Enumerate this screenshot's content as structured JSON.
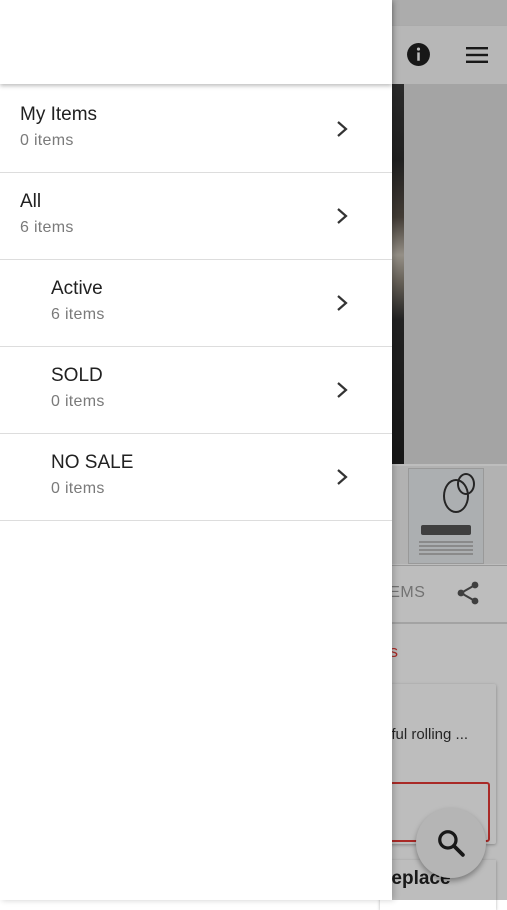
{
  "background": {
    "items_tab_label": "ITEMS",
    "section_link_text": "ns",
    "card_text": "iful rolling ...",
    "bottom_text": "replace"
  },
  "drawer": {
    "items": [
      {
        "title": "My Items",
        "count": "0 items"
      },
      {
        "title": "All",
        "count": "6 items"
      },
      {
        "title": "Active",
        "count": "6 items"
      },
      {
        "title": "SOLD",
        "count": "0 items"
      },
      {
        "title": "NO SALE",
        "count": "0 items"
      }
    ]
  },
  "icons": {
    "info": "info-icon",
    "menu": "hamburger-menu-icon",
    "share": "share-icon",
    "search": "search-icon",
    "chevron": "chevron-right-icon"
  },
  "colors": {
    "accent_red": "#e53935",
    "text_primary": "#212121",
    "text_secondary": "#7a7a7a"
  }
}
